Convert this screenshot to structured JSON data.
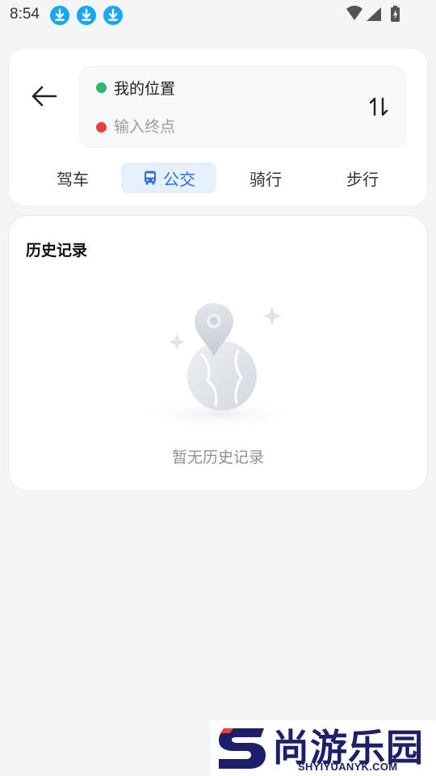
{
  "status_bar": {
    "time": "8:54",
    "notifications": [
      "download-icon",
      "download-icon",
      "download-icon"
    ],
    "system_icons": [
      "wifi-icon",
      "signal-icon",
      "battery-charging-icon"
    ]
  },
  "route": {
    "back_icon": "arrow-left-icon",
    "start_label": "我的位置",
    "end_placeholder": "输入终点",
    "swap_icon": "swap-vertical-icon",
    "start_dot_color": "#31b768",
    "end_dot_color": "#e8413a"
  },
  "tabs": [
    {
      "label": "驾车",
      "active": false
    },
    {
      "label": "公交",
      "active": true,
      "icon": "bus-icon"
    },
    {
      "label": "骑行",
      "active": false
    },
    {
      "label": "步行",
      "active": false
    }
  ],
  "history": {
    "title": "历史记录",
    "empty_text": "暂无历史记录",
    "illustration": "empty-map-globe-illustration"
  },
  "watermark": {
    "cn": "尚游乐园",
    "en": "SHYIYUANYK.COM"
  },
  "colors": {
    "accent": "#2f6fe6",
    "tab_active_bg": "#e7f0fd",
    "page_bg": "#f4f5f7"
  }
}
